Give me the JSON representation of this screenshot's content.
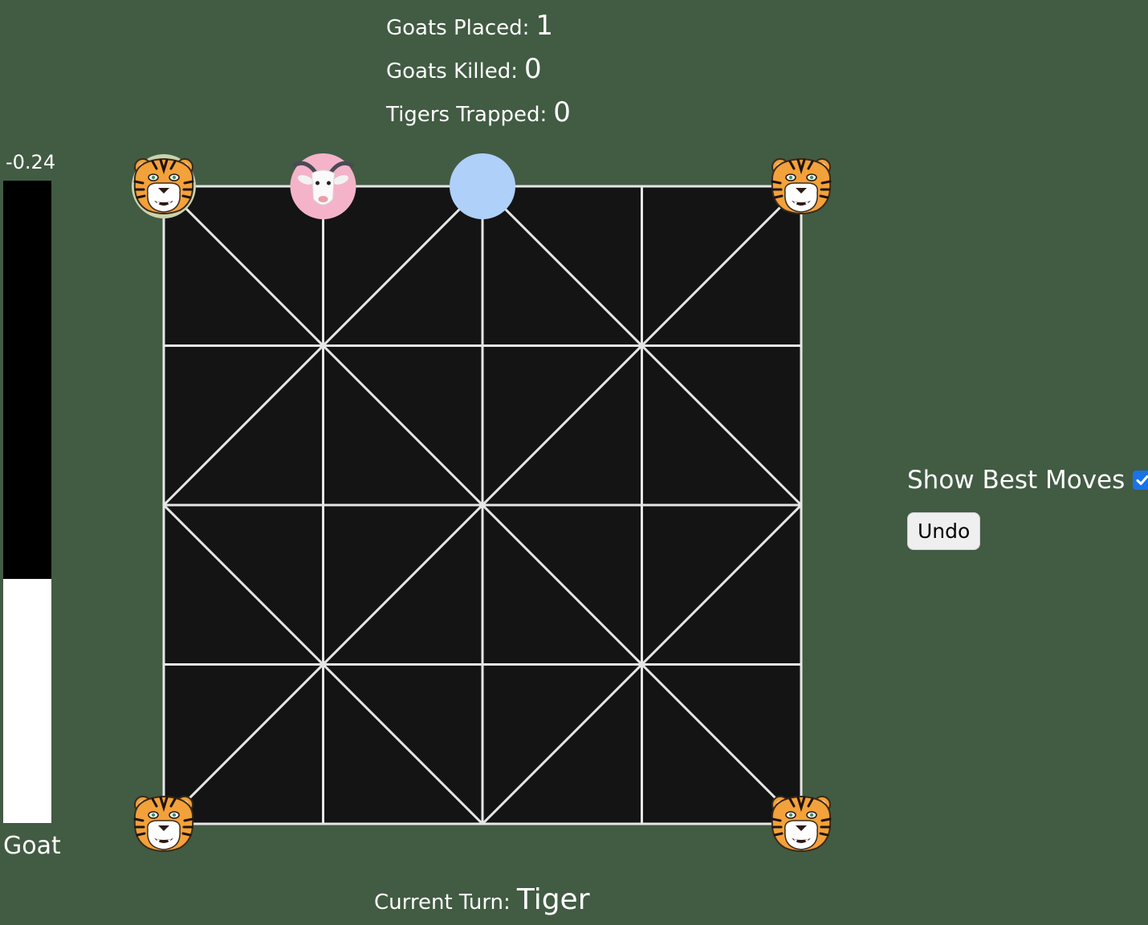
{
  "stats": {
    "goats_placed_label": "Goats Placed:",
    "goats_placed_value": "1",
    "goats_killed_label": "Goats Killed:",
    "goats_killed_value": "0",
    "tigers_trapped_label": "Tigers Trapped:",
    "tigers_trapped_value": "0"
  },
  "evaluation": {
    "value": "-0.24",
    "side_label": "Goat",
    "tiger_share": 0.62
  },
  "board": {
    "grid_size": 5,
    "pieces": [
      {
        "type": "tiger",
        "row": 0,
        "col": 0,
        "selected": true
      },
      {
        "type": "goat",
        "row": 0,
        "col": 1
      },
      {
        "type": "tiger",
        "row": 0,
        "col": 4
      },
      {
        "type": "tiger",
        "row": 4,
        "col": 0
      },
      {
        "type": "tiger",
        "row": 4,
        "col": 4
      }
    ],
    "hints": [
      {
        "row": 0,
        "col": 2
      }
    ]
  },
  "controls": {
    "show_best_moves_label": "Show Best Moves",
    "show_best_moves_checked": true,
    "undo_label": "Undo"
  },
  "turn": {
    "label": "Current Turn:",
    "value": "Tiger"
  },
  "colors": {
    "background": "#425b43",
    "board_fill": "#141414",
    "board_lines": "#e6e6e6",
    "hint": "#aed0f9",
    "goat_badge": "#f4b3c9",
    "tiger_orange": "#f3a13a",
    "selected_ring": "#c9d3ad"
  }
}
